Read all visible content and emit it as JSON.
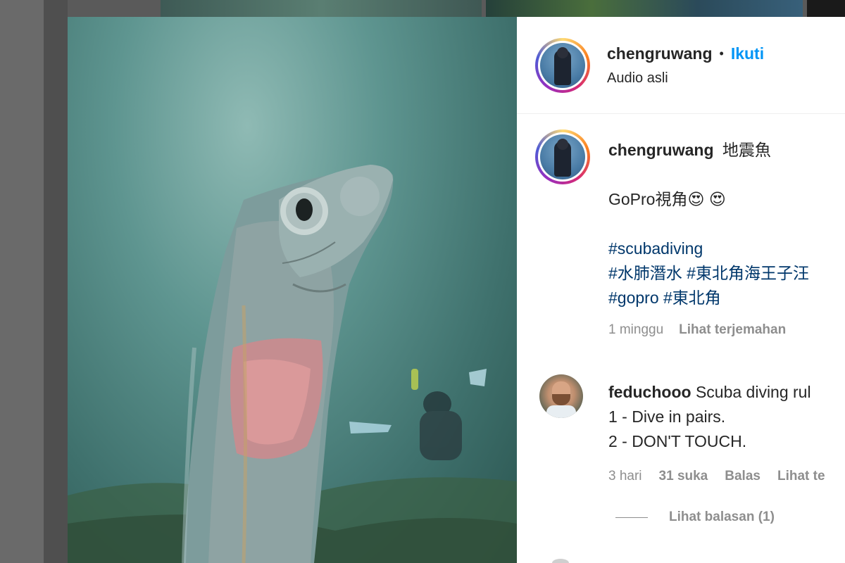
{
  "post": {
    "username": "chengruwang",
    "separator": "•",
    "follow_label": "Ikuti",
    "audio_label": "Audio asli"
  },
  "caption": {
    "username": "chengruwang",
    "text_first": "地震魚",
    "line2": "GoPro視角",
    "emoji": [
      "😍",
      "😍"
    ],
    "hashtags_line1": "#scubadiving",
    "hashtags_line2": "#水肺潛水 #東北角海王子汪",
    "hashtags_line3": "#gopro #東北角",
    "time": "1 minggu",
    "translate_label": "Lihat terjemahan"
  },
  "comment": {
    "username": "feduchooo",
    "text_first": "Scuba diving rul",
    "line2": "1 - Dive in pairs.",
    "line3": "2 - DON'T TOUCH.",
    "time": "3 hari",
    "likes": "31 suka",
    "reply_label": "Balas",
    "translate_label": "Lihat te",
    "view_replies": "Lihat balasan (1)"
  },
  "icons": {
    "profile_avatar": "diver-avatar-icon",
    "commenter_avatar": "person-avatar-icon"
  },
  "colors": {
    "follow": "#0095f6",
    "hashtag": "#00376b",
    "meta": "#8e8e8e"
  }
}
